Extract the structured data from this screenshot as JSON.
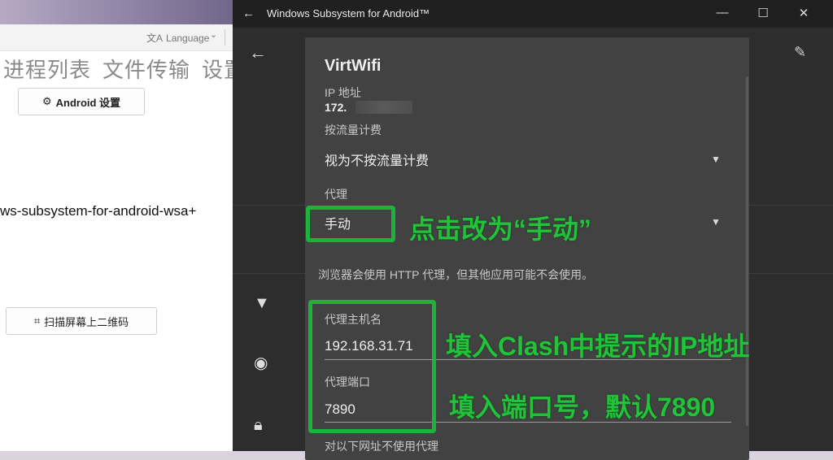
{
  "left_app": {
    "language_label": "Language",
    "tabs": [
      "进程列表",
      "文件传输",
      "设置"
    ],
    "android_settings_button": "Android 设置",
    "package_text": "ws-subsystem-for-android-wsa+",
    "scan_qr_button": "扫描屏幕上二维码"
  },
  "window": {
    "title": "Windows Subsystem for Android™"
  },
  "dialog": {
    "network_name": "VirtWifi",
    "ip_label": "IP 地址",
    "ip_value": "172.",
    "metered_label": "按流量计费",
    "metered_value": "视为不按流量计费",
    "proxy_label": "代理",
    "proxy_value": "手动",
    "proxy_note": "浏览器会使用 HTTP 代理，但其他应用可能不会使用。",
    "host_label": "代理主机名",
    "host_value": "192.168.31.71",
    "port_label": "代理端口",
    "port_value": "7890",
    "bypass_label": "对以下网址不使用代理"
  },
  "annotations": {
    "proxy_hint": "点击改为“手动”",
    "host_hint": "填入Clash中提示的IP地址",
    "port_hint": "填入端口号，默认7890"
  },
  "colors": {
    "annotation_green": "#23c23b",
    "dialog_bg": "#424242",
    "window_bg": "#2d2d2d"
  }
}
